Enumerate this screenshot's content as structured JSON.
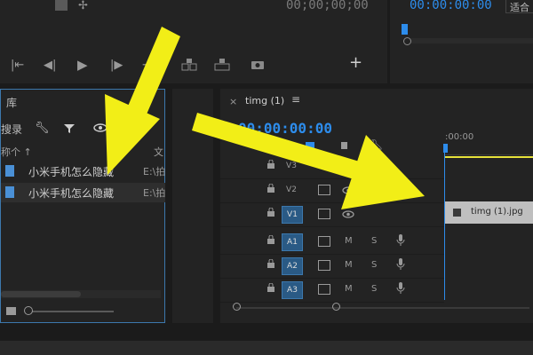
{
  "source_monitor": {
    "timecode": "00;00;00;00"
  },
  "program_monitor": {
    "timecode": "00:00:00:00",
    "fit_label": "适合"
  },
  "project_panel": {
    "title": "库",
    "search_label": "搜录",
    "column_name": "称个",
    "column_path": "文",
    "items": [
      {
        "name": "小米手机怎么隐藏",
        "path": "E:\\拍"
      },
      {
        "name": "小米手机怎么隐藏",
        "path": "E:\\拍"
      }
    ]
  },
  "timeline": {
    "sequence_name": "timg (1)",
    "timecode": "00:00:00:00",
    "ruler_start": ":00:00",
    "tracks": [
      {
        "label": "V3",
        "type": "video",
        "active": false
      },
      {
        "label": "V2",
        "type": "video",
        "active": false
      },
      {
        "label": "V1",
        "type": "video",
        "active": true
      },
      {
        "label": "A1",
        "type": "audio",
        "active": true
      },
      {
        "label": "A2",
        "type": "audio",
        "active": true
      },
      {
        "label": "A3",
        "type": "audio",
        "active": true
      }
    ],
    "audio_toggles": {
      "mute": "M",
      "solo": "S"
    },
    "clip": {
      "name": "timg (1).jpg"
    }
  },
  "colors": {
    "accent": "#2d8ceb",
    "arrow": "#f2ee17",
    "background": "#232323"
  }
}
